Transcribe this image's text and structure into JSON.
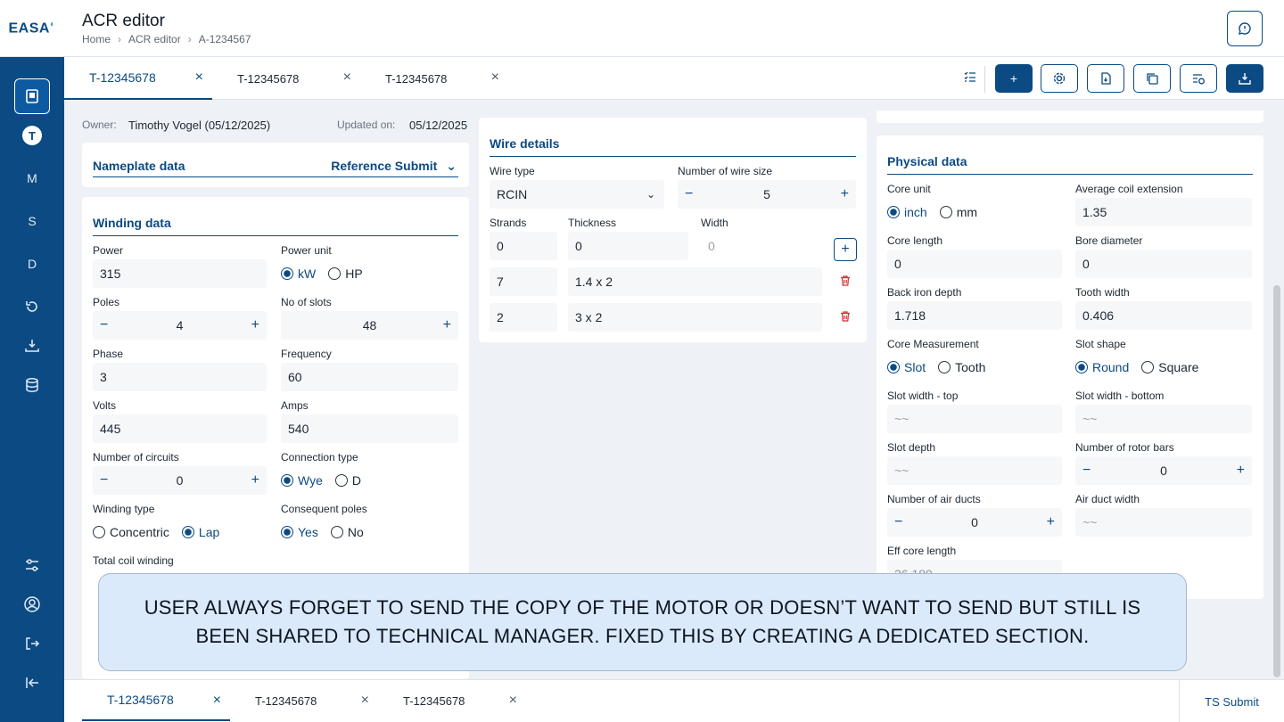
{
  "app": {
    "logo": "EASA"
  },
  "header": {
    "title": "ACR editor",
    "breadcrumb": [
      "Home",
      "ACR editor",
      "A-1234567"
    ]
  },
  "sidebar": {
    "items": [
      "T",
      "M",
      "S",
      "D"
    ]
  },
  "tabs": [
    {
      "label": "T-12345678",
      "active": true
    },
    {
      "label": "T-12345678",
      "active": false
    },
    {
      "label": "T-12345678",
      "active": false
    }
  ],
  "meta": {
    "owner_label": "Owner:",
    "owner_value": "Timothy Vogel (05/12/2025)",
    "updated_label": "Updated on:",
    "updated_value": "05/12/2025"
  },
  "nameplate": {
    "title": "Nameplate data",
    "reference": "Reference Submit"
  },
  "winding": {
    "title": "Winding data",
    "power_label": "Power",
    "power_value": "315",
    "power_unit_label": "Power unit",
    "power_unit_options": [
      "kW",
      "HP"
    ],
    "poles_label": "Poles",
    "poles_value": "4",
    "slots_label": "No of slots",
    "slots_value": "48",
    "phase_label": "Phase",
    "phase_value": "3",
    "frequency_label": "Frequency",
    "frequency_value": "60",
    "volts_label": "Volts",
    "volts_value": "445",
    "amps_label": "Amps",
    "amps_value": "540",
    "circuits_label": "Number of circuits",
    "circuits_value": "0",
    "connection_label": "Connection type",
    "connection_options": [
      "Wye",
      "D"
    ],
    "winding_type_label": "Winding type",
    "winding_type_options": [
      "Concentric",
      "Lap"
    ],
    "consequent_label": "Consequent poles",
    "consequent_options": [
      "Yes",
      "No"
    ],
    "total_coil_label": "Total coil winding"
  },
  "wire": {
    "title": "Wire details",
    "wire_type_label": "Wire type",
    "wire_type_value": "RCIN",
    "wire_size_label": "Number of wire size",
    "wire_size_value": "5",
    "strands_label": "Strands",
    "thickness_label": "Thickness",
    "width_label": "Width",
    "new_row": {
      "strands": "0",
      "thickness": "0",
      "width": "0"
    },
    "rows": [
      {
        "strands": "7",
        "dims": "1.4 x 2"
      },
      {
        "strands": "2",
        "dims": "3 x 2"
      }
    ]
  },
  "physical": {
    "title": "Physical data",
    "core_unit_label": "Core unit",
    "core_unit_options": [
      "inch",
      "mm"
    ],
    "avg_coil_label": "Average coil extension",
    "avg_coil_value": "1.35",
    "core_length_label": "Core length",
    "core_length_value": "0",
    "bore_label": "Bore diameter",
    "bore_value": "0",
    "back_iron_label": "Back iron depth",
    "back_iron_value": "1.718",
    "tooth_width_label": "Tooth width",
    "tooth_width_value": "0.406",
    "core_meas_label": "Core Measurement",
    "core_meas_options": [
      "Slot",
      "Tooth"
    ],
    "slot_shape_label": "Slot shape",
    "slot_shape_options": [
      "Round",
      "Square"
    ],
    "slot_top_label": "Slot width - top",
    "slot_top_value": "~~",
    "slot_bottom_label": "Slot width - bottom",
    "slot_bottom_value": "~~",
    "slot_depth_label": "Slot depth",
    "slot_depth_value": "~~",
    "rotor_bars_label": "Number of rotor bars",
    "rotor_bars_value": "0",
    "air_ducts_label": "Number of air ducts",
    "air_ducts_value": "0",
    "air_duct_width_label": "Air duct width",
    "air_duct_width_value": "~~",
    "eff_core_label": "Eff core length",
    "eff_core_value": "26.189"
  },
  "toast": {
    "text": "USER ALWAYS FORGET TO SEND THE COPY OF THE MOTOR OR DOESN’T WANT TO SEND BUT STILL IS BEEN SHARED TO TECHNICAL MANAGER. FIXED THIS BY CREATING A DEDICATED SECTION."
  },
  "footer": {
    "submit": "TS Submit"
  },
  "colors": {
    "primary": "#0b4a82",
    "danger": "#cf2e2e",
    "toast_bg": "#dbeafa"
  }
}
